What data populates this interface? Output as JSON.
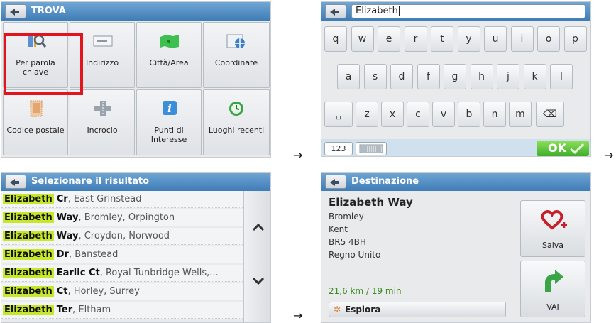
{
  "panel_find": {
    "title": "TROVA",
    "items": [
      {
        "label": "Per parola chiave",
        "icon": "keyword-search-icon",
        "selected": true
      },
      {
        "label": "Indirizzo",
        "icon": "address-icon"
      },
      {
        "label": "Città/Area",
        "icon": "city-area-icon"
      },
      {
        "label": "Coordinate",
        "icon": "coordinates-icon"
      },
      {
        "label": "Codice postale",
        "icon": "postcode-icon"
      },
      {
        "label": "Incrocio",
        "icon": "intersection-icon"
      },
      {
        "label": "Punti di Interesse",
        "icon": "info-icon"
      },
      {
        "label": "Luoghi recenti",
        "icon": "clock-icon"
      }
    ]
  },
  "panel_keyboard": {
    "input_value": "Elizabeth",
    "row1": [
      "q",
      "w",
      "e",
      "r",
      "t",
      "y",
      "u",
      "i",
      "o",
      "p"
    ],
    "row2": [
      "a",
      "s",
      "d",
      "f",
      "g",
      "h",
      "j",
      "k",
      "l"
    ],
    "row3": [
      "␣",
      "z",
      "x",
      "c",
      "v",
      "b",
      "n",
      "m",
      "⌫"
    ],
    "num_label": "123",
    "ok_label": "OK"
  },
  "panel_results": {
    "title": "Selezionare il risultato",
    "rows": [
      {
        "match": "Elizabeth",
        "street": "Cr",
        "rest": ", East Grinstead"
      },
      {
        "match": "Elizabeth",
        "street": "Way",
        "rest": ", Bromley, Orpington"
      },
      {
        "match": "Elizabeth",
        "street": "Way",
        "rest": ", Croydon, Norwood"
      },
      {
        "match": "Elizabeth",
        "street": "Dr",
        "rest": ", Banstead"
      },
      {
        "match": "Elizabeth",
        "street": "Earlic Ct",
        "rest": ", Royal Tunbridge Wells,..."
      },
      {
        "match": "Elizabeth",
        "street": "Ct",
        "rest": ", Horley, Surrey"
      },
      {
        "match": "Elizabeth",
        "street": "Ter",
        "rest": ", Eltham"
      }
    ]
  },
  "panel_destination": {
    "title": "Destinazione",
    "name": "Elizabeth Way",
    "lines": [
      "Bromley",
      "Kent",
      "BR5 4BH",
      "Regno Unito"
    ],
    "distance": "21,6 km / 19 min",
    "explore_label": "Esplora",
    "save_label": "Salva",
    "go_label": "VAI"
  },
  "arrows": [
    "→",
    "→",
    "→"
  ],
  "colors": {
    "titlebar": "#4f8cc4",
    "highlight": "#c8e62a",
    "selection": "#e3141b",
    "ok": "#4cbb2f"
  }
}
